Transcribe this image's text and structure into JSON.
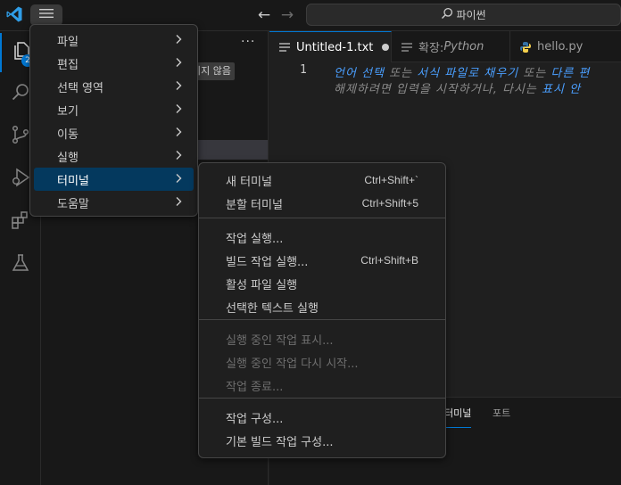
{
  "titlebar": {
    "search_text": "파이썬"
  },
  "activity": {
    "explorer_badge": "2"
  },
  "sidebar": {
    "more_label": "···",
    "pill_text": "지지 않음"
  },
  "tabs": [
    {
      "label": "Untitled-1.txt"
    },
    {
      "prefix": "확장: ",
      "label": "Python"
    },
    {
      "label": "hello.py"
    }
  ],
  "editor": {
    "line_number": "1",
    "hint_line1_parts": [
      {
        "text": "언어 선택",
        "hl": true
      },
      {
        "text": " 또는 ",
        "hl": false
      },
      {
        "text": "서식 파일로 채우기",
        "hl": true
      },
      {
        "text": " 또는 ",
        "hl": false
      },
      {
        "text": "다른 편",
        "hl": true
      }
    ],
    "hint_line2_parts": [
      {
        "text": "해제하려면 입력을 시작하거나, 다시는 ",
        "hl": false
      },
      {
        "text": "표시 안",
        "hl": true
      }
    ]
  },
  "panel": {
    "tabs": [
      {
        "label": "터미널",
        "active": true
      },
      {
        "label": "포트",
        "active": false
      }
    ]
  },
  "menu": {
    "items": [
      {
        "label": "파일"
      },
      {
        "label": "편집"
      },
      {
        "label": "선택 영역"
      },
      {
        "label": "보기"
      },
      {
        "label": "이동"
      },
      {
        "label": "실행"
      },
      {
        "label": "터미널",
        "active": true
      },
      {
        "label": "도움말"
      }
    ]
  },
  "terminal_submenu": {
    "groups": [
      [
        {
          "label": "새 터미널",
          "shortcut": "Ctrl+Shift+`"
        },
        {
          "label": "분할 터미널",
          "shortcut": "Ctrl+Shift+5"
        }
      ],
      [
        {
          "label": "작업 실행...",
          "shortcut": ""
        },
        {
          "label": "빌드 작업 실행...",
          "shortcut": "Ctrl+Shift+B"
        },
        {
          "label": "활성 파일 실행",
          "shortcut": ""
        },
        {
          "label": "선택한 텍스트 실행",
          "shortcut": ""
        }
      ],
      [
        {
          "label": "실행 중인 작업 표시...",
          "shortcut": "",
          "disabled": true
        },
        {
          "label": "실행 중인 작업 다시 시작...",
          "shortcut": "",
          "disabled": true
        },
        {
          "label": "작업 종료...",
          "shortcut": "",
          "disabled": true
        }
      ],
      [
        {
          "label": "작업 구성...",
          "shortcut": ""
        },
        {
          "label": "기본 빌드 작업 구성...",
          "shortcut": ""
        }
      ]
    ]
  },
  "colors": {
    "accent": "#0078d4",
    "menu_active_bg": "#04395e",
    "hint_highlight": "#4a9fff"
  }
}
